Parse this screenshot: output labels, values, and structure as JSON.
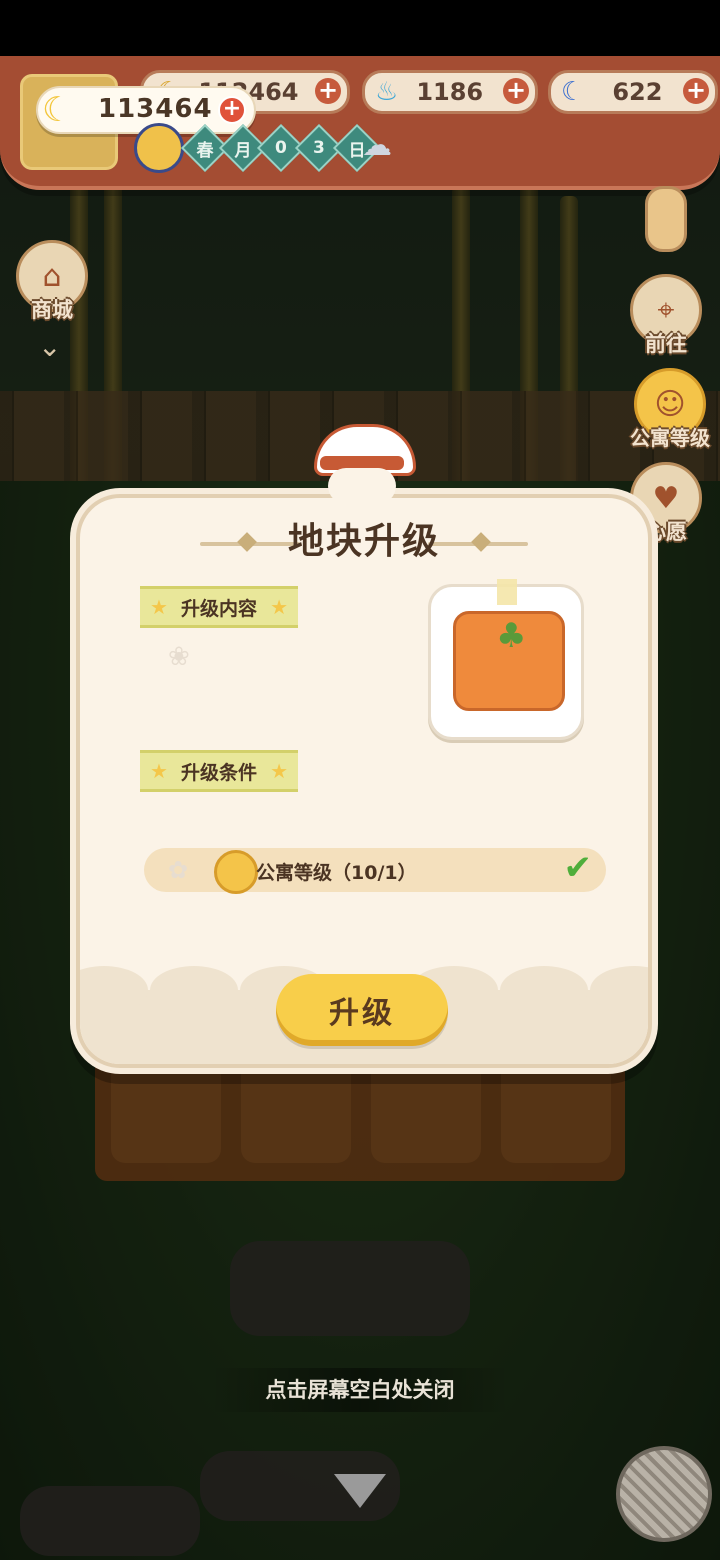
{
  "hud": {
    "main_currency": "113464",
    "resources": [
      {
        "icon": "banana-icon",
        "value": "112464"
      },
      {
        "icon": "blue-flame-icon",
        "value": "1186"
      },
      {
        "icon": "blue-banana-icon",
        "value": "622"
      }
    ],
    "date": {
      "chars": [
        "春",
        "月",
        "0",
        "3",
        "日"
      ]
    },
    "weather": "rain-cloud-icon"
  },
  "side_left": {
    "shop_label": "商城"
  },
  "side_right": {
    "goto_label": "前往",
    "apartment_level_label": "公寓等级",
    "wish_label": "心愿"
  },
  "modal": {
    "title": "地块升级",
    "content_tag": "升级内容",
    "condition_tag": "升级条件",
    "condition_text": "公寓等级（10/1）",
    "condition_met": true,
    "upgrade_button": "升级"
  },
  "footer": {
    "close_hint": "点击屏幕空白处关闭"
  },
  "colors": {
    "banner": "#a44d33",
    "modal_bg": "#fbf3e7",
    "button": "#f8ce4a",
    "check": "#4fae3b"
  }
}
